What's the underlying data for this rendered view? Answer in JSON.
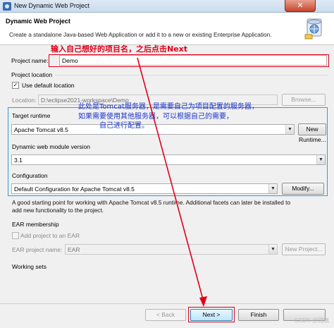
{
  "window": {
    "title": "New Dynamic Web Project",
    "close_label": "✕"
  },
  "header": {
    "title": "Dynamic Web Project",
    "description": "Create a standalone Java-based Web Application or add it to a new or existing Enterprise Application."
  },
  "project_name": {
    "label": "Project name:",
    "value": "Demo"
  },
  "project_location": {
    "heading": "Project location",
    "use_default_label": "Use default location",
    "use_default_checked": true,
    "location_label": "Location:",
    "location_value": "D:\\eclipse2021-workspace\\Demo",
    "browse_label": "Browse..."
  },
  "target_runtime": {
    "heading": "Target runtime",
    "value": "Apache Tomcat v8.5",
    "button_label": "New Runtime..."
  },
  "module_version": {
    "heading": "Dynamic web module version",
    "value": "3.1"
  },
  "configuration": {
    "heading": "Configuration",
    "value": "Default Configuration for Apache Tomcat v8.5",
    "button_label": "Modify...",
    "description_line1": "A good starting point for working with Apache Tomcat v8.5 runtime. Additional facets can later be installed to",
    "description_line2": "add new functionality to the project."
  },
  "ear_membership": {
    "heading": "EAR membership",
    "add_label": "Add project to an EAR",
    "add_checked": false,
    "ear_name_label": "EAR project name:",
    "ear_name_value": "EAR",
    "new_project_label": "New Project..."
  },
  "working_sets": {
    "heading": "Working sets"
  },
  "footer": {
    "back_label": "< Back",
    "next_label": "Next >",
    "finish_label": "Finish"
  },
  "annotations": {
    "red_note": "输入自己想好的项目名，之后点击Next",
    "blue_note_line1": "此处是Tomcat服务器，是需要自己为项目配置的服务器，",
    "blue_note_line2": "如果需要使用其他服务器，可以根据自己的需要，",
    "blue_note_line3": "自己进行配置。",
    "red_color": "#e0001a",
    "blue_color": "#1a33c8"
  },
  "watermark": "CSDN @琉璃"
}
